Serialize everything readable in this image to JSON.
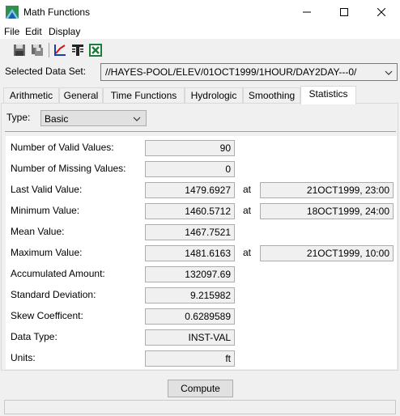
{
  "window": {
    "title": "Math Functions"
  },
  "menu": [
    "File",
    "Edit",
    "Display"
  ],
  "toolbar": {
    "icons": [
      "save-icon",
      "save-as-icon",
      "plot-icon",
      "table-icon",
      "excel-icon"
    ]
  },
  "dataset": {
    "label": "Selected Data Set:",
    "value": "//HAYES-POOL/ELEV/01OCT1999/1HOUR/DAY2DAY---0/"
  },
  "tabs": [
    {
      "label": "Arithmetic",
      "active": false
    },
    {
      "label": "General",
      "active": false
    },
    {
      "label": "Time Functions",
      "active": false
    },
    {
      "label": "Hydrologic",
      "active": false
    },
    {
      "label": "Smoothing",
      "active": false
    },
    {
      "label": "Statistics",
      "active": true
    }
  ],
  "type": {
    "label": "Type:",
    "value": "Basic"
  },
  "stats": {
    "at_label": "at",
    "rows": [
      {
        "label": "Number of Valid Values:",
        "value": "90"
      },
      {
        "label": "Number of Missing Values:",
        "value": "0"
      },
      {
        "label": "Last Valid Value:",
        "value": "1479.6927",
        "date": "21OCT1999, 23:00"
      },
      {
        "label": "Minimum Value:",
        "value": "1460.5712",
        "date": "18OCT1999, 24:00"
      },
      {
        "label": "Mean Value:",
        "value": "1467.7521"
      },
      {
        "label": "Maximum Value:",
        "value": "1481.6163",
        "date": "21OCT1999, 10:00"
      },
      {
        "label": "Accumulated Amount:",
        "value": "132097.69"
      },
      {
        "label": "Standard Deviation:",
        "value": "9.215982"
      },
      {
        "label": "Skew Coefficent:",
        "value": "0.6289589"
      },
      {
        "label": "Data Type:",
        "value": "INST-VAL"
      },
      {
        "label": "Units:",
        "value": "ft"
      }
    ]
  },
  "compute_label": "Compute"
}
